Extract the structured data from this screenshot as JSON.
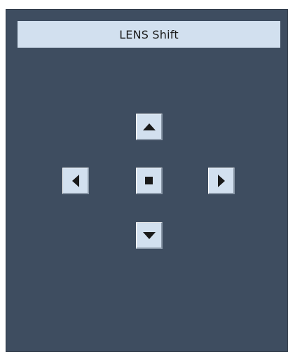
{
  "lens_shift": {
    "title": "LENS Shift",
    "controls": {
      "up_icon": "triangle-up-icon",
      "left_icon": "triangle-left-icon",
      "center_icon": "square-stop-icon",
      "right_icon": "triangle-right-icon",
      "down_icon": "triangle-down-icon"
    },
    "colors": {
      "panel_background": "#3e4d60",
      "button_face": "#d2e0ef",
      "icon_color": "#1a1a1a"
    }
  }
}
